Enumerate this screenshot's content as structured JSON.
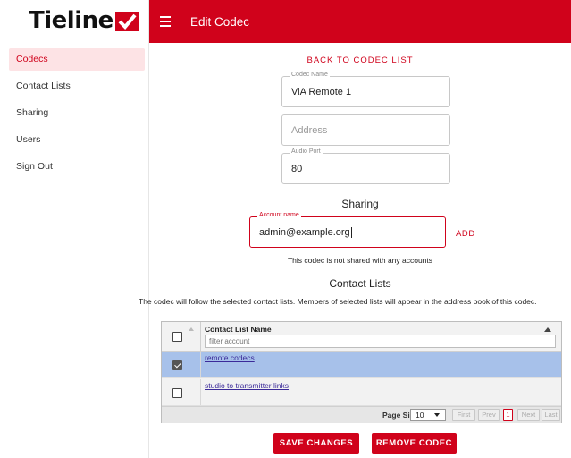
{
  "brand": {
    "logo_text": "Tieline",
    "accent": "#d0021b"
  },
  "sidebar": {
    "items": [
      {
        "label": "Codecs",
        "active": true
      },
      {
        "label": "Contact Lists"
      },
      {
        "label": "Sharing"
      },
      {
        "label": "Users"
      },
      {
        "label": "Sign Out"
      }
    ]
  },
  "header": {
    "title": "Edit Codec",
    "menu_icon": "hamburger-icon"
  },
  "form": {
    "back_link": "BACK TO CODEC LIST",
    "codec_name": {
      "label": "Codec Name",
      "value": "ViA Remote 1"
    },
    "address": {
      "placeholder": "Address",
      "value": ""
    },
    "audio_port": {
      "label": "Audio Port",
      "value": "80"
    }
  },
  "sharing": {
    "title": "Sharing",
    "account": {
      "label": "Account name",
      "value": "admin@example.org"
    },
    "add_label": "ADD",
    "note": "This codec is not shared with any accounts"
  },
  "contact_lists": {
    "title": "Contact Lists",
    "description": "The codec will follow the selected contact lists. Members of selected lists will appear in the address book of this codec.",
    "column_header": "Contact List Name",
    "filter_placeholder": "filter account",
    "rows": [
      {
        "name": "remote codecs",
        "selected": true
      },
      {
        "name": "studio to transmitter links",
        "selected": false
      }
    ],
    "pager": {
      "page_size_label": "Page Size",
      "page_size": "10",
      "first": "First",
      "prev": "Prev",
      "current": "1",
      "next": "Next",
      "last": "Last"
    }
  },
  "actions": {
    "save": "SAVE CHANGES",
    "remove": "REMOVE CODEC"
  }
}
